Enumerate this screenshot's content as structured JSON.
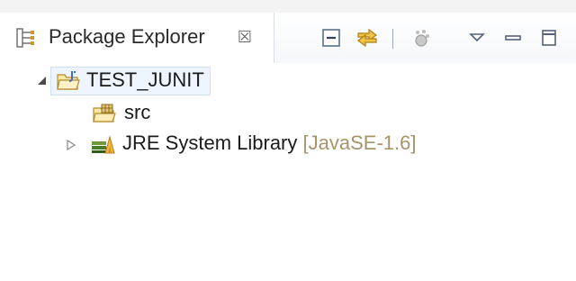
{
  "view": {
    "title": "Package Explorer",
    "close_glyph": "☒",
    "icon": "package-explorer-icon"
  },
  "toolbar": {
    "buttons": [
      {
        "name": "collapse-all",
        "icon": "collapse-all-icon"
      },
      {
        "name": "link-with-editor",
        "icon": "link-with-editor-icon"
      },
      {
        "name": "focus-on-active-task",
        "icon": "focus-task-icon"
      },
      {
        "name": "view-menu",
        "icon": "view-menu-icon"
      },
      {
        "name": "minimize",
        "icon": "minimize-icon"
      },
      {
        "name": "maximize",
        "icon": "maximize-icon"
      }
    ]
  },
  "tree": {
    "project": {
      "label": "TEST_JUNIT",
      "icon": "java-project-icon",
      "expanded": true
    },
    "children": [
      {
        "label": "src",
        "icon": "source-folder-icon"
      },
      {
        "label": "JRE System Library",
        "decoration": "[JavaSE-1.6]",
        "icon": "jre-library-icon",
        "expanded": false
      }
    ]
  },
  "colors": {
    "decoration": "#a8936a",
    "selection_bg": "#eef5fe",
    "selection_border": "#cfe1f7"
  }
}
